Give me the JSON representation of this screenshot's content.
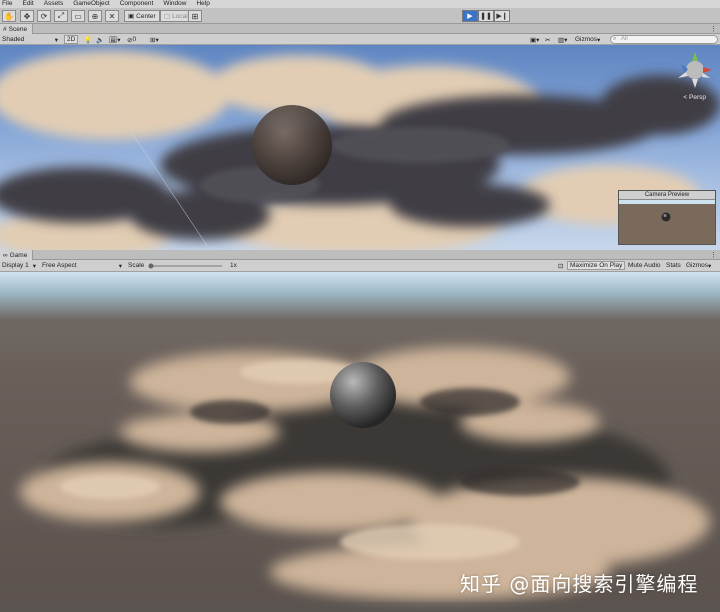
{
  "menu": [
    "File",
    "Edit",
    "Assets",
    "GameObject",
    "Component",
    "Window",
    "Help"
  ],
  "toolbar": {
    "tools": [
      "hand-icon",
      "move-icon",
      "rotate-icon",
      "scale-icon",
      "rect-icon",
      "transform-icon",
      "custom-tool-icon"
    ],
    "pivot_label": "Center",
    "space_label": "Local",
    "play_active": true
  },
  "scene": {
    "tab_label": "Scene",
    "shading_mode": "Shaded",
    "mode_2d": "2D",
    "hidden_count": "0",
    "gizmos_label": "Gizmos",
    "search_placeholder": "All",
    "persp_label": "< Persp",
    "camera_preview_title": "Camera Preview"
  },
  "game": {
    "tab_label": "Game",
    "display": "Display 1",
    "aspect": "Free Aspect",
    "scale_label": "Scale",
    "scale_value": 1,
    "scale_value_label": "1x",
    "maximize_label": "Maximize On Play",
    "mute_label": "Mute Audio",
    "stats_label": "Stats",
    "gizmos_label": "Gizmos"
  },
  "watermark": "知乎 @面向搜索引擎编程",
  "colors": {
    "play_active": "#3b73c6",
    "sky_top": "#5f86c2",
    "cloud_dark": "#3d3c42",
    "cloud_light": "#d8c4ad",
    "ground": "#6a605a"
  }
}
